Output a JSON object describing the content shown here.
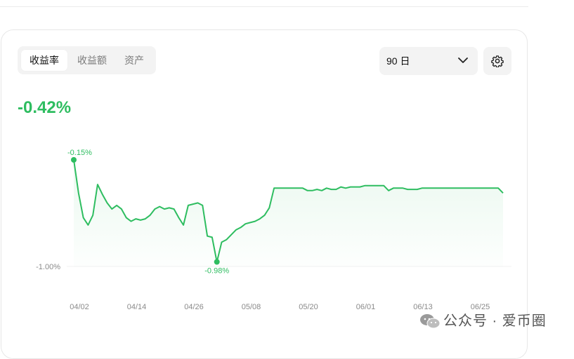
{
  "tabs": [
    {
      "label": "收益率",
      "active": true
    },
    {
      "label": "收益额",
      "active": false
    },
    {
      "label": "资产",
      "active": false
    }
  ],
  "period": {
    "selected": "90 日"
  },
  "settings": {
    "icon": "gear-icon"
  },
  "summary": {
    "return_pct": "-0.42%"
  },
  "colors": {
    "positive": "#2ebd60",
    "fill_top": "#e9f8ee"
  },
  "chart_data": {
    "type": "area",
    "x_tick_labels": [
      "04/02",
      "04/14",
      "04/26",
      "05/08",
      "05/20",
      "06/01",
      "06/13",
      "06/25"
    ],
    "y_tick_labels": [
      "-1.00%"
    ],
    "ylim": [
      -1.0,
      -0.15
    ],
    "x": [
      0,
      1,
      2,
      3,
      4,
      5,
      6,
      7,
      8,
      9,
      10,
      11,
      12,
      13,
      14,
      15,
      16,
      17,
      18,
      19,
      20,
      21,
      22,
      23,
      24,
      25,
      26,
      27,
      28,
      29,
      30,
      31,
      32,
      33,
      34,
      35,
      36,
      37,
      38,
      39,
      40,
      41,
      42,
      43,
      44,
      45,
      46,
      47,
      48,
      49,
      50,
      51,
      52,
      53,
      54,
      55,
      56,
      57,
      58,
      59,
      60,
      61,
      62,
      63,
      64,
      65,
      66,
      67,
      68,
      69,
      70,
      71,
      72,
      73,
      74,
      75,
      76,
      77,
      78,
      79,
      80,
      81,
      82,
      83,
      84,
      85,
      86,
      87,
      88,
      89,
      90
    ],
    "series": [
      {
        "values": [
          -0.15,
          -0.42,
          -0.62,
          -0.68,
          -0.6,
          -0.35,
          -0.43,
          -0.5,
          -0.55,
          -0.52,
          -0.55,
          -0.62,
          -0.65,
          -0.63,
          -0.64,
          -0.63,
          -0.6,
          -0.55,
          -0.53,
          -0.55,
          -0.54,
          -0.55,
          -0.62,
          -0.68,
          -0.52,
          -0.51,
          -0.5,
          -0.52,
          -0.77,
          -0.78,
          -0.98,
          -0.82,
          -0.8,
          -0.76,
          -0.72,
          -0.7,
          -0.67,
          -0.66,
          -0.65,
          -0.63,
          -0.6,
          -0.54,
          -0.38,
          -0.38,
          -0.38,
          -0.38,
          -0.38,
          -0.38,
          -0.38,
          -0.4,
          -0.4,
          -0.39,
          -0.4,
          -0.38,
          -0.39,
          -0.39,
          -0.37,
          -0.38,
          -0.37,
          -0.37,
          -0.37,
          -0.36,
          -0.36,
          -0.36,
          -0.36,
          -0.36,
          -0.4,
          -0.38,
          -0.38,
          -0.38,
          -0.39,
          -0.39,
          -0.39,
          -0.38,
          -0.38,
          -0.38,
          -0.38,
          -0.38,
          -0.38,
          -0.38,
          -0.38,
          -0.38,
          -0.38,
          -0.38,
          -0.38,
          -0.38,
          -0.38,
          -0.38,
          -0.38,
          -0.38,
          -0.42
        ]
      }
    ],
    "annotations": [
      {
        "label": "-0.15%",
        "x": 0,
        "y": -0.15
      },
      {
        "label": "-0.98%",
        "x": 30,
        "y": -0.98
      }
    ],
    "grid": false
  },
  "watermark": {
    "text": "公众号 · 爱币圈",
    "icon": "wechat-icon"
  }
}
